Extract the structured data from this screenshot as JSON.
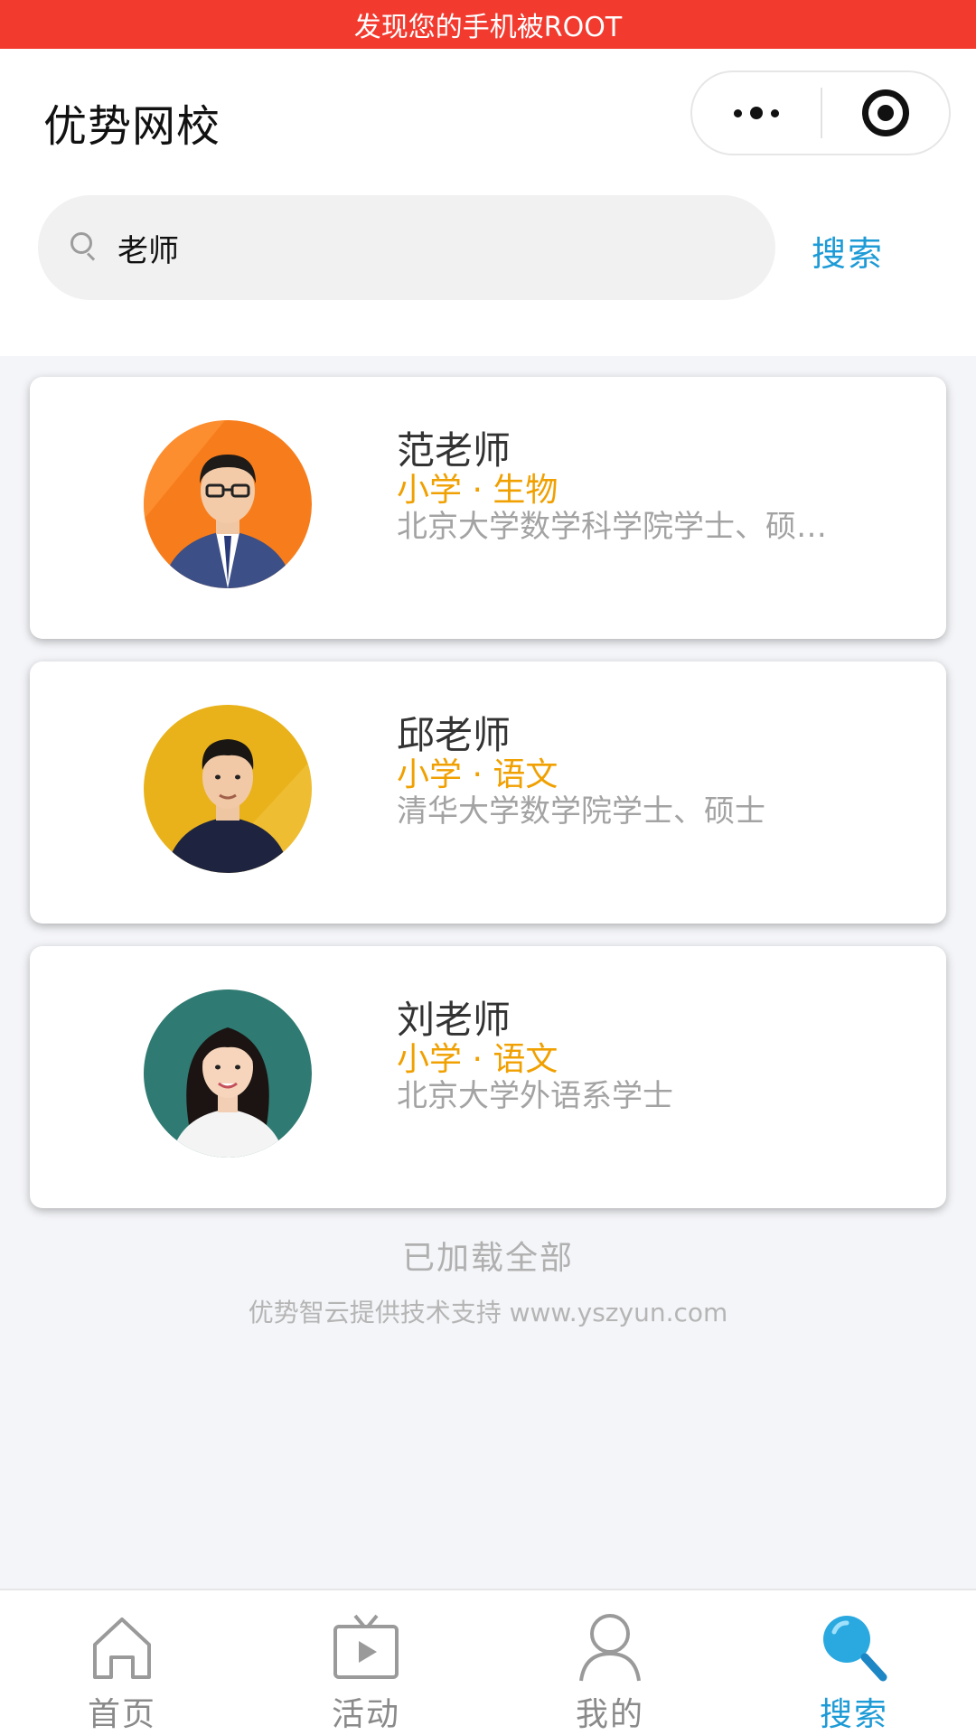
{
  "status_warning": "发现您的手机被ROOT",
  "header": {
    "title": "优势网校",
    "more_icon": "more-dots-icon",
    "close_icon": "target-circle-icon"
  },
  "search": {
    "value": "老师",
    "placeholder": "",
    "button_label": "搜索"
  },
  "teachers": [
    {
      "name": "范老师",
      "subject": "小学 · 生物",
      "description": "北京大学数学科学院学士、硕…",
      "avatar_bg": "#f77d1c"
    },
    {
      "name": "邱老师",
      "subject": "小学 · 语文",
      "description": "清华大学数学院学士、硕士",
      "avatar_bg": "#e9b21b"
    },
    {
      "name": "刘老师",
      "subject": "小学 · 语文",
      "description": "北京大学外语系学士",
      "avatar_bg": "#2f7a72"
    }
  ],
  "footer": {
    "loaded_all": "已加载全部",
    "powered_by": "优势智云提供技术支持 www.yszyun.com"
  },
  "tabbar": {
    "tabs": [
      {
        "label": "首页",
        "icon": "home-icon",
        "active": false
      },
      {
        "label": "活动",
        "icon": "tv-play-icon",
        "active": false
      },
      {
        "label": "我的",
        "icon": "user-icon",
        "active": false
      },
      {
        "label": "搜索",
        "icon": "search-icon",
        "active": true
      }
    ]
  },
  "colors": {
    "accent": "#1d9bd6",
    "subject": "#f0a000",
    "warning_bar": "#f23a2f"
  }
}
